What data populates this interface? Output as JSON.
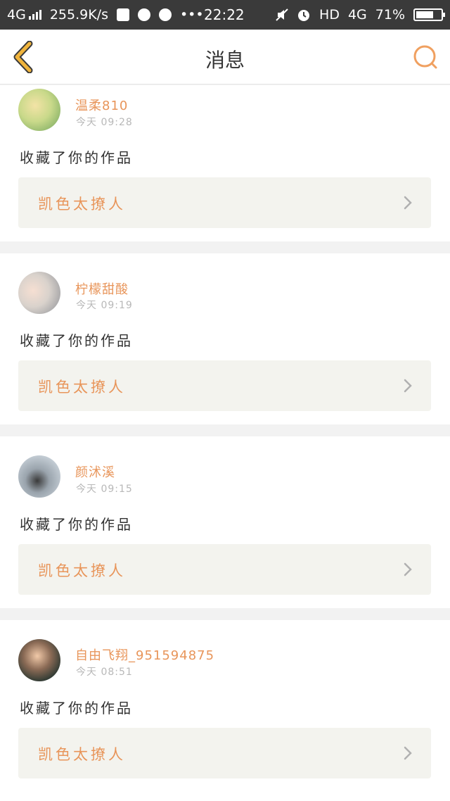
{
  "status_bar": {
    "network": "4G",
    "speed": "255.9K/s",
    "time": "22:22",
    "hd": "HD",
    "network2": "4G",
    "battery": "71%",
    "battery_level": 0.71
  },
  "header": {
    "title": "消息",
    "back_icon": "chevron-left-icon",
    "search_icon": "search-icon"
  },
  "colors": {
    "accent": "#e8955a",
    "back_icon": "#f0b43c",
    "search_icon": "#f0a060",
    "work_box_bg": "#f3f3ee"
  },
  "notifications": [
    {
      "username": "温柔810",
      "time": "今天 09:28",
      "action": "收藏了你的作品",
      "work_title": "凯色太撩人",
      "avatar": "avatar-image"
    },
    {
      "username": "柠檬甜酸",
      "time": "今天 09:19",
      "action": "收藏了你的作品",
      "work_title": "凯色太撩人",
      "avatar": "avatar-image"
    },
    {
      "username": "颜沭溪",
      "time": "今天 09:15",
      "action": "收藏了你的作品",
      "work_title": "凯色太撩人",
      "avatar": "avatar-image"
    },
    {
      "username": "自由飞翔_951594875",
      "time": "今天 08:51",
      "action": "收藏了你的作品",
      "work_title": "凯色太撩人",
      "avatar": "avatar-image"
    }
  ]
}
